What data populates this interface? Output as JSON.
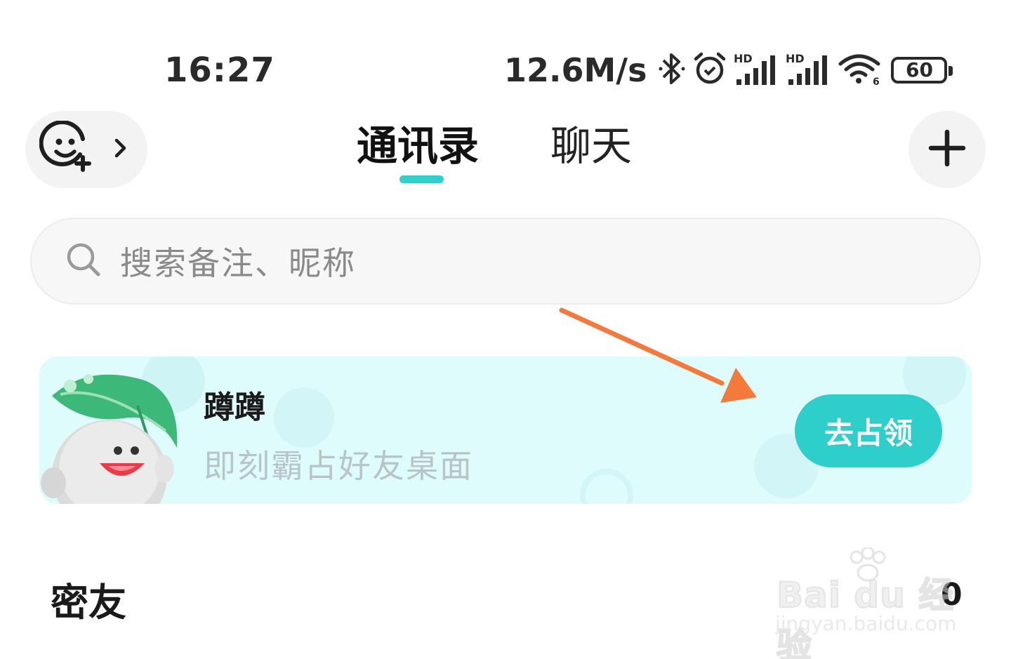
{
  "status_bar": {
    "time": "16:27",
    "net_speed": "12.6M/s",
    "battery": "60",
    "icons": [
      "bluetooth-icon",
      "alarm-icon",
      "hd-signal-icon",
      "hd-signal-icon",
      "wifi-icon",
      "battery-icon"
    ]
  },
  "header": {
    "tabs": [
      {
        "label": "通讯录",
        "active": true
      },
      {
        "label": "聊天",
        "active": false
      }
    ],
    "left_icon": "add-friend-smiley-icon",
    "right_icon": "plus-icon"
  },
  "search": {
    "placeholder": "搜索备注、昵称"
  },
  "banner": {
    "title": "蹲蹲",
    "subtitle": "即刻霸占好友桌面",
    "button_label": "去占领"
  },
  "section": {
    "title": "密友",
    "count": "0"
  },
  "watermark": {
    "main": "Bai du 经验",
    "url": "jingyan.baidu.com"
  },
  "colors": {
    "accent": "#2ecfcb",
    "banner_bg": "#dffcfd",
    "annotation_arrow": "#f47a3c"
  }
}
